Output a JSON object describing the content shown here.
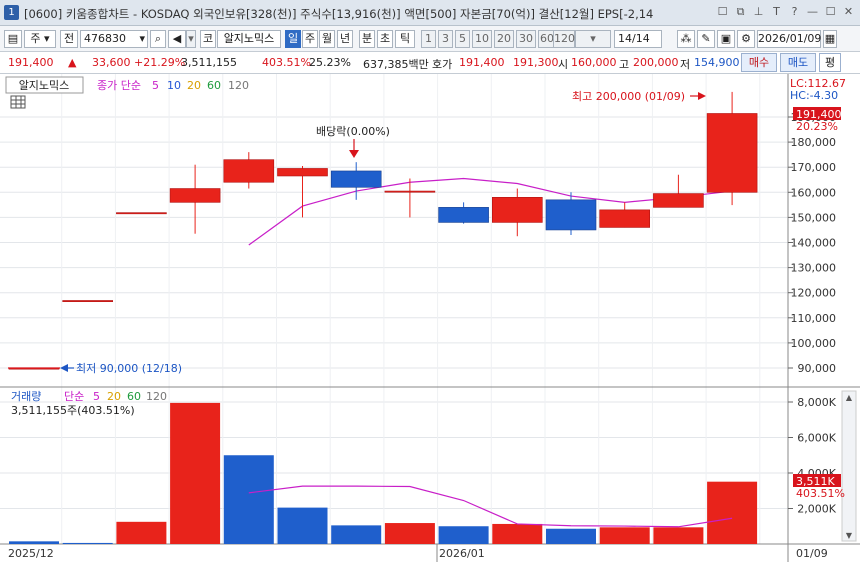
{
  "titlebar": {
    "window_number": "1",
    "title": "[0600] 키움종합차트 - KOSDAQ 외국인보유[328(천)] 주식수[13,916(천)] 액면[500] 자본금[70(억)] 결산[12월] EPS[-2,14",
    "controls": [
      "☐",
      "⧉",
      "⊥",
      "T",
      "?",
      "—",
      "☐",
      "✕"
    ]
  },
  "toolbar": {
    "type_label": "주",
    "view_label": "전",
    "stock_code": "476830",
    "market": "코",
    "stock_name": "알지노믹스",
    "periods": [
      "일",
      "주",
      "월",
      "년",
      "분",
      "초",
      "틱"
    ],
    "selected_period": "일",
    "intervals": [
      "1",
      "3",
      "5",
      "10",
      "20",
      "30",
      "60",
      "120"
    ],
    "count": "14",
    "total": "/14",
    "date": "2026/01/09"
  },
  "infobar": {
    "price": "191,400",
    "arrow": "▲",
    "change": "33,600",
    "change_pct": "+21.29%",
    "volume": "3,511,155",
    "volume_ratio": "403.51%",
    "turnover": "25.23%",
    "amount": "637,385백만",
    "quote_label": "호가",
    "ask": "191,400",
    "bid": "191,300",
    "open_label": "시",
    "open": "160,000",
    "high_label": "고",
    "high": "200,000",
    "low_label": "저",
    "low": "154,900",
    "buy": "매수",
    "sell": "매도",
    "eval": "평"
  },
  "price_panel": {
    "name_tag": "알지노믹스",
    "legend_label": "종가 단순",
    "legend_periods": [
      {
        "label": "5",
        "color": "#c81fc8"
      },
      {
        "label": "10",
        "color": "#2456d8"
      },
      {
        "label": "20",
        "color": "#d8a000"
      },
      {
        "label": "60",
        "color": "#1e9b3c"
      },
      {
        "label": "120",
        "color": "#777777"
      }
    ],
    "lc": "LC:112.67",
    "hc": "HC:-4.30",
    "current_price": "191,400",
    "current_pct": "20.23%",
    "dividend_label": "배당락(0.00%)",
    "high_note": "최고 200,000 (01/09)",
    "low_note": "최저 90,000 (12/18)"
  },
  "volume_panel": {
    "title": "거래량",
    "legend_label": "단순",
    "legend_periods": [
      {
        "label": "5",
        "color": "#c81fc8"
      },
      {
        "label": "20",
        "color": "#d8a000"
      },
      {
        "label": "60",
        "color": "#1e9b3c"
      },
      {
        "label": "120",
        "color": "#777777"
      }
    ],
    "volume_text": "3,511,155주(403.51%)",
    "current_volume": "3,511K",
    "current_pct": "403.51%"
  },
  "x_axis": {
    "left": "2025/12",
    "mid": "2026/01",
    "right": "01/09"
  },
  "chart_data": {
    "type": "candlestick",
    "price_axis_ticks": [
      "90,000",
      "100,000",
      "110,000",
      "120,000",
      "130,000",
      "140,000",
      "150,000",
      "160,000",
      "170,000",
      "180,000",
      "190,000"
    ],
    "volume_axis_ticks": [
      "2,000K",
      "4,000K",
      "6,000K",
      "8,000K"
    ],
    "candles": [
      {
        "open": 90000,
        "close": 90000,
        "high": 90000,
        "low": 90000,
        "color": "red"
      },
      {
        "open": 116900,
        "close": 116900,
        "high": 116900,
        "low": 116900,
        "color": "red"
      },
      {
        "open": 151900,
        "close": 151900,
        "high": 151900,
        "low": 151900,
        "color": "red"
      },
      {
        "open": 156000,
        "close": 161500,
        "high": 171000,
        "low": 143500,
        "color": "red"
      },
      {
        "open": 164000,
        "close": 173000,
        "high": 176000,
        "low": 161500,
        "color": "red"
      },
      {
        "open": 166500,
        "close": 169500,
        "high": 170500,
        "low": 150000,
        "color": "red"
      },
      {
        "open": 168500,
        "close": 162000,
        "high": 172000,
        "low": 157000,
        "color": "blue"
      },
      {
        "open": 160500,
        "close": 160500,
        "high": 165500,
        "low": 150000,
        "color": "red"
      },
      {
        "open": 154000,
        "close": 148000,
        "high": 156000,
        "low": 147500,
        "color": "blue"
      },
      {
        "open": 148000,
        "close": 158000,
        "high": 161500,
        "low": 142500,
        "color": "red"
      },
      {
        "open": 157000,
        "close": 145000,
        "high": 160000,
        "low": 143000,
        "color": "blue"
      },
      {
        "open": 146000,
        "close": 153000,
        "high": 156000,
        "low": 146000,
        "color": "red"
      },
      {
        "open": 154000,
        "close": 159500,
        "high": 167000,
        "low": 154000,
        "color": "red"
      },
      {
        "open": 160000,
        "close": 191400,
        "high": 200000,
        "low": 154900,
        "color": "red"
      }
    ],
    "ma5": [
      null,
      null,
      null,
      null,
      139000,
      154500,
      160500,
      164000,
      165500,
      163500,
      158500,
      156000,
      158000,
      160500
    ],
    "volume": [
      {
        "v": 150,
        "color": "blue"
      },
      {
        "v": 60,
        "color": "blue"
      },
      {
        "v": 1250,
        "color": "red"
      },
      {
        "v": 7950,
        "color": "red"
      },
      {
        "v": 5000,
        "color": "blue"
      },
      {
        "v": 2050,
        "color": "blue"
      },
      {
        "v": 1050,
        "color": "blue"
      },
      {
        "v": 1180,
        "color": "red"
      },
      {
        "v": 1000,
        "color": "blue"
      },
      {
        "v": 1130,
        "color": "red"
      },
      {
        "v": 860,
        "color": "blue"
      },
      {
        "v": 940,
        "color": "red"
      },
      {
        "v": 940,
        "color": "red"
      },
      {
        "v": 3511,
        "color": "red"
      }
    ],
    "volume_ma5": [
      null,
      null,
      null,
      null,
      2882,
      3262,
      3260,
      3240,
      2450,
      1130,
      1030,
      1010,
      970,
      1450
    ]
  }
}
